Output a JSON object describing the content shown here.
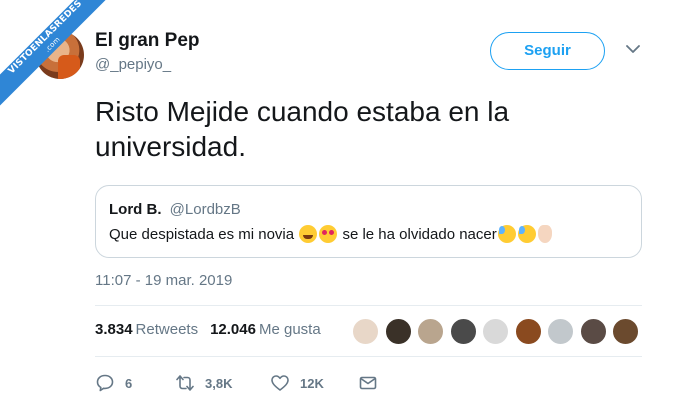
{
  "watermark": {
    "main": "VISTOENLASREDES",
    "sub": ".com"
  },
  "user": {
    "name": "El gran Pep",
    "handle": "@_pepiyo_"
  },
  "follow_label": "Seguir",
  "tweet": {
    "text": "Risto Mejide cuando estaba en la universidad."
  },
  "quote": {
    "name": "Lord B.",
    "handle": "@LordbzB",
    "text_part1": "Que despistada es mi novia",
    "text_part2": "se le ha olvidado nacer",
    "emoji_icons": [
      "face-with-tears-of-joy-icon",
      "heart-eyes-icon",
      "sweat-smile-icon",
      "sweat-smile-icon",
      "ok-hand-icon"
    ]
  },
  "timestamp": "11:07 - 19 mar. 2019",
  "stats": {
    "retweets_count": "3.834",
    "retweets_label": "Retweets",
    "likes_count": "12.046",
    "likes_label": "Me gusta"
  },
  "likers_colors": [
    "#e8d7c8",
    "#3a3128",
    "#b9a58e",
    "#4a4a4a",
    "#d9d9d9",
    "#8a4a1f",
    "#c2c8cc",
    "#5a4b45",
    "#6b4a2e"
  ],
  "actions": {
    "reply_count": "6",
    "retweet_count": "3,8K",
    "like_count": "12K"
  },
  "colors": {
    "accent": "#1da1f2",
    "muted": "#657786",
    "border": "#ccd6dd"
  }
}
